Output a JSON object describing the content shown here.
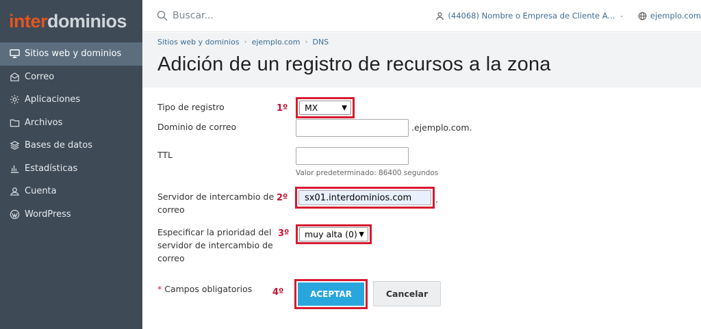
{
  "logo": {
    "part1": "inter",
    "part2": "dominios"
  },
  "sidebar": {
    "items": [
      {
        "label": "Sitios web y dominios",
        "icon": "monitor-icon"
      },
      {
        "label": "Correo",
        "icon": "mail-icon"
      },
      {
        "label": "Aplicaciones",
        "icon": "gear-icon"
      },
      {
        "label": "Archivos",
        "icon": "folder-icon"
      },
      {
        "label": "Bases de datos",
        "icon": "database-icon"
      },
      {
        "label": "Estadísticas",
        "icon": "bar-chart-icon"
      },
      {
        "label": "Cuenta",
        "icon": "account-icon"
      },
      {
        "label": "WordPress",
        "icon": "wordpress-icon"
      }
    ],
    "active_index": 0,
    "collapse_glyph": "‹"
  },
  "topbar": {
    "search_placeholder": "Buscar...",
    "account": "(44068) Nombre o Empresa de Cliente A...",
    "domain": "ejemplo.com"
  },
  "breadcrumb": [
    "Sitios web y dominios",
    "ejemplo.com",
    "DNS"
  ],
  "page_title": "Adición de un registro de recursos a la zona",
  "form": {
    "record_type_label": "Tipo de registro",
    "record_type_value": "MX",
    "mail_domain_label": "Dominio de correo",
    "mail_domain_value": "",
    "mail_domain_suffix": ".ejemplo.com.",
    "ttl_label": "TTL",
    "ttl_value": "",
    "ttl_hint": "Valor predeterminado: 86400 segundos",
    "mx_server_label_1": "Servidor de intercambio de",
    "mx_server_label_2": "correo",
    "mx_server_value": "sx01.interdominios.com",
    "mx_server_suffix": ".",
    "priority_label_1": "Especificar la prioridad del",
    "priority_label_2": "servidor de intercambio de",
    "priority_label_3": "correo",
    "priority_value": "muy alta (0)",
    "required_star": "*",
    "required_text": "Campos obligatorios",
    "accept_label": "ACEPTAR",
    "cancel_label": "Cancelar"
  },
  "steps": [
    "1º",
    "2º",
    "3º",
    "4º"
  ],
  "colors": {
    "sidebar_bg": "#3e4a56",
    "sidebar_active": "#5c6e7e",
    "logo_orange": "#e5541f",
    "link_blue": "#3d6d93",
    "annotation_red": "#d61a30",
    "accept_blue": "#2aa6de"
  }
}
